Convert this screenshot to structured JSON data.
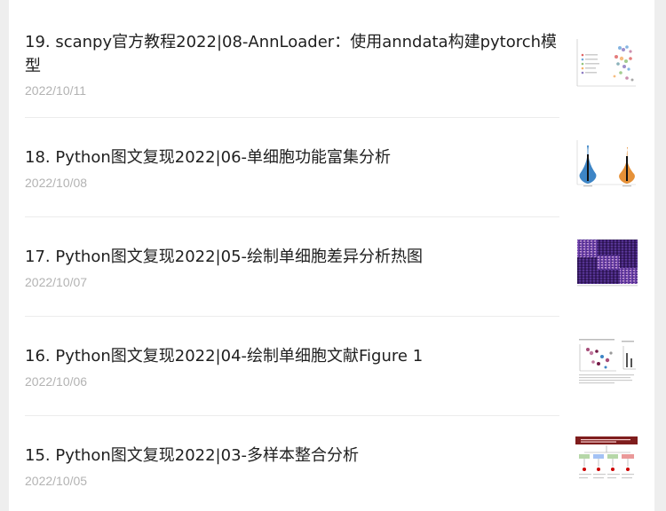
{
  "articles": [
    {
      "title": "19. scanpy官方教程2022|08-AnnLoader：使用anndata构建pytorch模型",
      "date": "2022/10/11",
      "thumbnail": "umap-scatter-thumbnail"
    },
    {
      "title": "18. Python图文复现2022|06-单细胞功能富集分析",
      "date": "2022/10/08",
      "thumbnail": "violin-plot-thumbnail"
    },
    {
      "title": "17. Python图文复现2022|05-绘制单细胞差异分析热图",
      "date": "2022/10/07",
      "thumbnail": "heatmap-thumbnail"
    },
    {
      "title": "16. Python图文复现2022|04-绘制单细胞文献Figure 1",
      "date": "2022/10/06",
      "thumbnail": "figure-panel-thumbnail"
    },
    {
      "title": "15. Python图文复现2022|03-多样本整合分析",
      "date": "2022/10/05",
      "thumbnail": "workflow-diagram-thumbnail"
    }
  ],
  "colors": {
    "title_text": "#1f1f1f",
    "date_text": "#b3b3b3",
    "divider": "#ececec",
    "page_background": "#eeeeee",
    "card_background": "#ffffff"
  }
}
